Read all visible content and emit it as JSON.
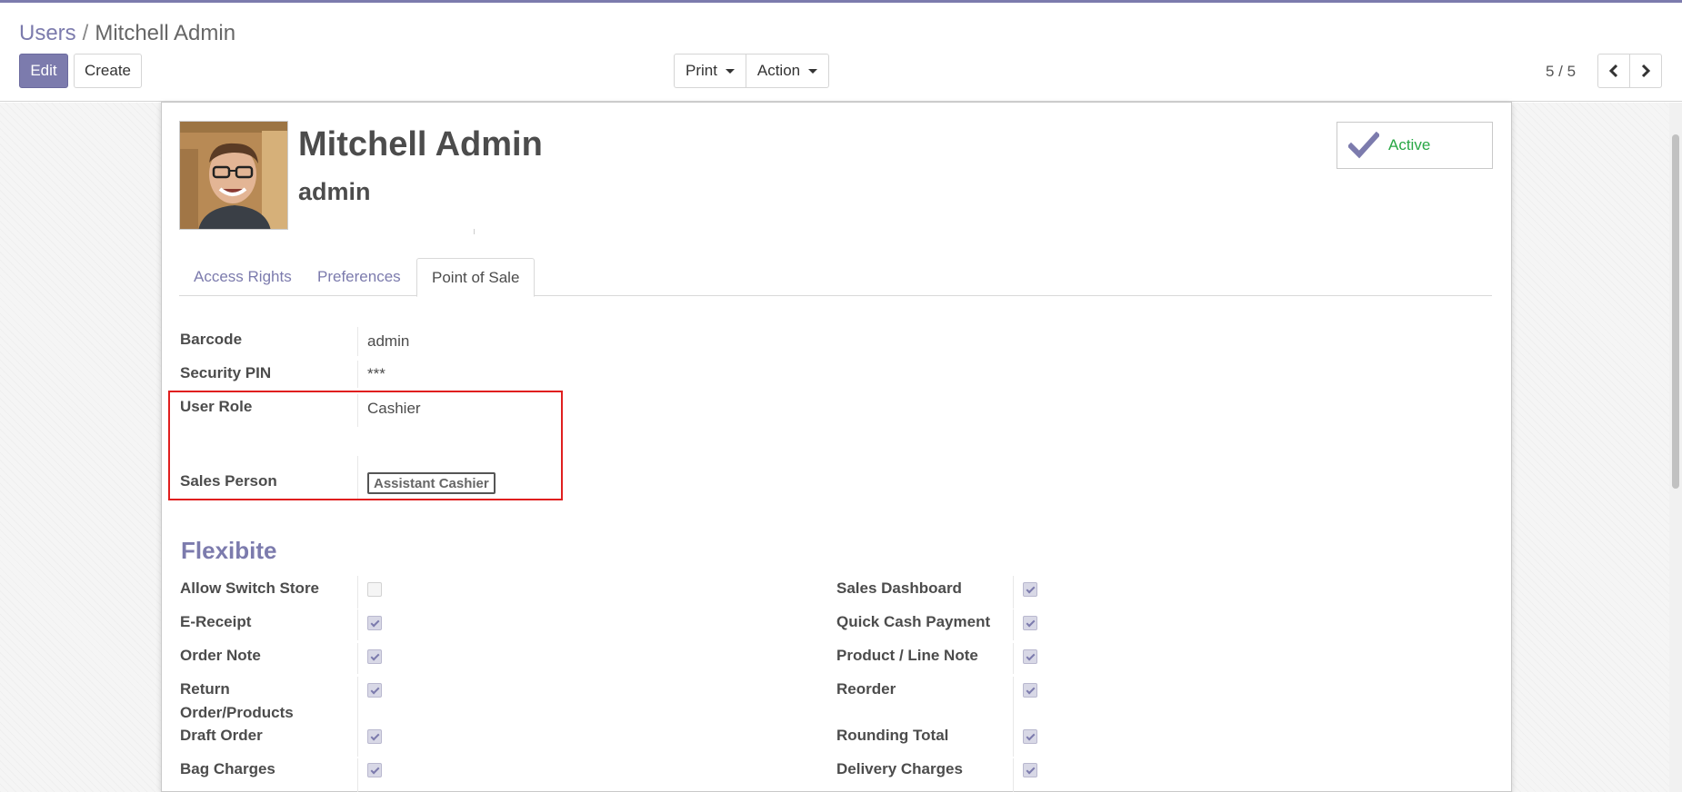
{
  "breadcrumb": {
    "parent": "Users",
    "separator": "/",
    "current": "Mitchell Admin"
  },
  "toolbar": {
    "edit_label": "Edit",
    "create_label": "Create",
    "print_label": "Print",
    "action_label": "Action"
  },
  "pager": {
    "value": "5 / 5"
  },
  "user": {
    "name": "Mitchell Admin",
    "login": "admin",
    "status_label": "Active"
  },
  "tabs": [
    {
      "label": "Access Rights",
      "active": false
    },
    {
      "label": "Preferences",
      "active": false
    },
    {
      "label": "Point of Sale",
      "active": true
    }
  ],
  "pos": {
    "barcode": {
      "label": "Barcode",
      "value": "admin"
    },
    "security_pin": {
      "label": "Security PIN",
      "value": "***"
    },
    "user_role": {
      "label": "User Role",
      "value": "Cashier"
    },
    "sales_person": {
      "label": "Sales Person",
      "value": "Assistant Cashier"
    }
  },
  "flexibite": {
    "title": "Flexibite",
    "left": [
      {
        "label": "Allow Switch Store",
        "checked": false
      },
      {
        "label": "E-Receipt",
        "checked": true
      },
      {
        "label": "Order Note",
        "checked": true
      },
      {
        "label": "Return",
        "label2": "Order/Products",
        "checked": true
      },
      {
        "label": "Draft Order",
        "checked": true
      },
      {
        "label": "Bag Charges",
        "checked": true
      }
    ],
    "right": [
      {
        "label": "Sales Dashboard",
        "checked": true
      },
      {
        "label": "Quick Cash Payment",
        "checked": true
      },
      {
        "label": "Product / Line Note",
        "checked": true
      },
      {
        "label": "Reorder",
        "checked": true
      },
      {
        "label": "Rounding Total",
        "checked": true
      },
      {
        "label": "Delivery Charges",
        "checked": true
      }
    ]
  },
  "colors": {
    "brand": "#7c7bad",
    "active_status": "#28a745",
    "highlight": "#e01f1f"
  }
}
